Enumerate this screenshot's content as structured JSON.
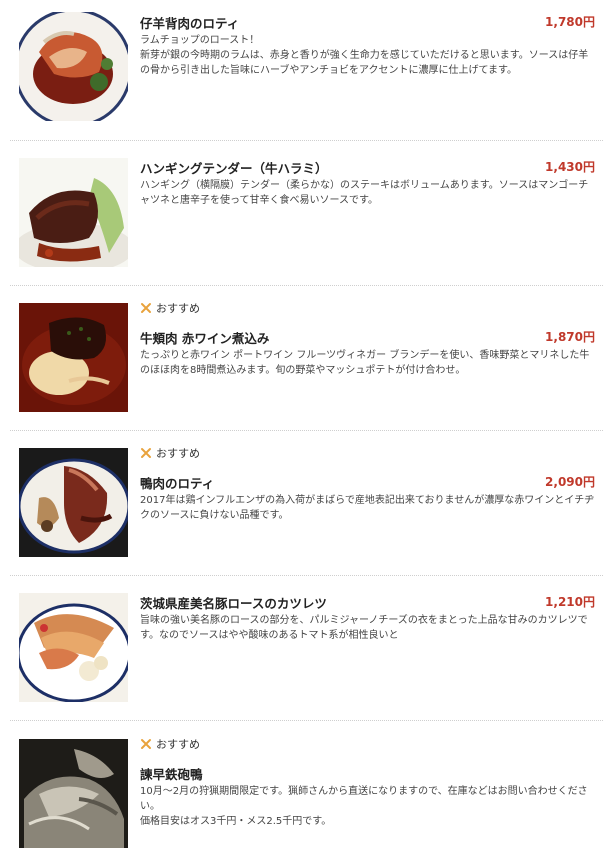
{
  "recommend_label": "おすすめ",
  "items": [
    {
      "name": "仔羊背肉のロティ",
      "price": "1,780円",
      "recommended": false,
      "desc": [
        "ラムチョップのロースト！",
        "新芽が銀の今時期のラムは、赤身と香りが強く生命力を感じていただけると思います。ソースは仔羊の骨から引き出した旨味にハーブやアンチョビをアクセントに濃厚に仕上げてます。"
      ]
    },
    {
      "name": "ハンギングテンダー（牛ハラミ）",
      "price": "1,430円",
      "recommended": false,
      "desc": [
        "ハンギング（横隔膜）テンダー（柔らかな）のステーキはボリュームあります。ソースはマンゴーチャツネと唐辛子を使って甘辛く食べ易いソースです。"
      ]
    },
    {
      "name": "牛頬肉 赤ワイン煮込み",
      "price": "1,870円",
      "recommended": true,
      "desc": [
        "たっぷりと赤ワイン ポートワイン フルーツヴィネガー ブランデーを使い、香味野菜とマリネした牛のほほ肉を8時間煮込みます。旬の野菜やマッシュポテトが付け合わせ。"
      ]
    },
    {
      "name": "鴨肉のロティ",
      "price": "2,090円",
      "recommended": true,
      "desc": [
        "2017年は鶏インフルエンザの為入荷がまばらで産地表記出来ておりませんが濃厚な赤ワインとイチヂクのソースに負けない品種です。"
      ]
    },
    {
      "name": "茨城県産美名豚ロースのカツレツ",
      "price": "1,210円",
      "recommended": false,
      "desc": [
        "旨味の強い美名豚のロースの部分を、パルミジャーノチーズの衣をまとった上品な甘みのカツレツです。なのでソースはやや酸味のあるトマト系が相性良いと"
      ]
    },
    {
      "name": "諫早鉄砲鴨",
      "price": "",
      "recommended": true,
      "desc": [
        "10月～2月の狩猟期間限定です。猟師さんから直送になりますので、在庫などはお問い合わせください。",
        "価格目安はオス3千円・メス2.5千円です。"
      ]
    }
  ],
  "icons": {
    "recommend": "crossed-cutlery-icon"
  },
  "colors": {
    "price": "#c0392b",
    "recommend_icon": "#e8a33d",
    "divider": "#cfcfcf"
  }
}
